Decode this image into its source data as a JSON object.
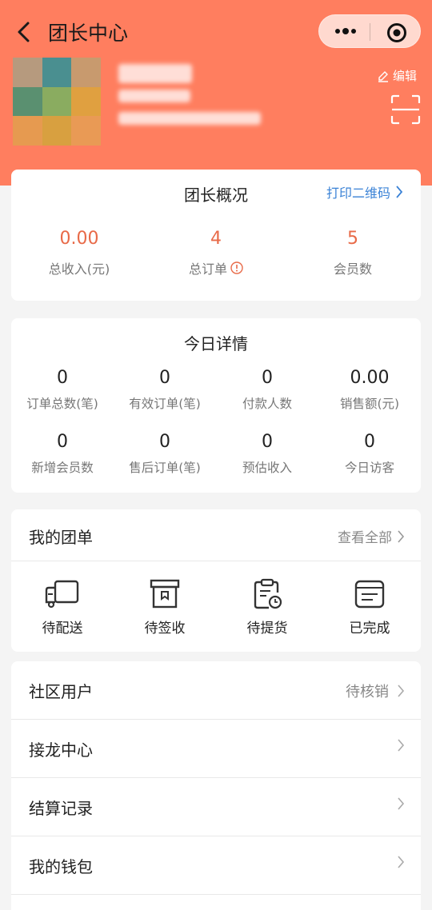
{
  "nav": {
    "title": "团长中心"
  },
  "profile": {
    "edit_label": "编辑"
  },
  "overview": {
    "title": "团长概况",
    "print_qr": "打印二维码",
    "stats": [
      {
        "value": "0.00",
        "label": "总收入(元)"
      },
      {
        "value": "4",
        "label": "总订单"
      },
      {
        "value": "5",
        "label": "会员数"
      }
    ]
  },
  "today": {
    "title": "今日详情",
    "items": [
      {
        "value": "0",
        "label": "订单总数(笔)"
      },
      {
        "value": "0",
        "label": "有效订单(笔)"
      },
      {
        "value": "0",
        "label": "付款人数"
      },
      {
        "value": "0.00",
        "label": "销售额(元)"
      },
      {
        "value": "0",
        "label": "新增会员数"
      },
      {
        "value": "0",
        "label": "售后订单(笔)"
      },
      {
        "value": "0",
        "label": "预估收入"
      },
      {
        "value": "0",
        "label": "今日访客"
      }
    ]
  },
  "my_group": {
    "title": "我的团单",
    "view_all": "查看全部",
    "items": [
      {
        "label": "待配送",
        "icon": "truck-icon"
      },
      {
        "label": "待签收",
        "icon": "box-icon"
      },
      {
        "label": "待提货",
        "icon": "clipboard-clock-icon"
      },
      {
        "label": "已完成",
        "icon": "card-icon"
      }
    ]
  },
  "menu": [
    {
      "label": "社区用户",
      "right": "待核销"
    },
    {
      "label": "接龙中心",
      "right": ""
    },
    {
      "label": "结算记录",
      "right": ""
    },
    {
      "label": "我的钱包",
      "right": ""
    }
  ],
  "colors": {
    "header": "#ff7e5f",
    "accent": "#e86a48",
    "link": "#3a82d6"
  }
}
